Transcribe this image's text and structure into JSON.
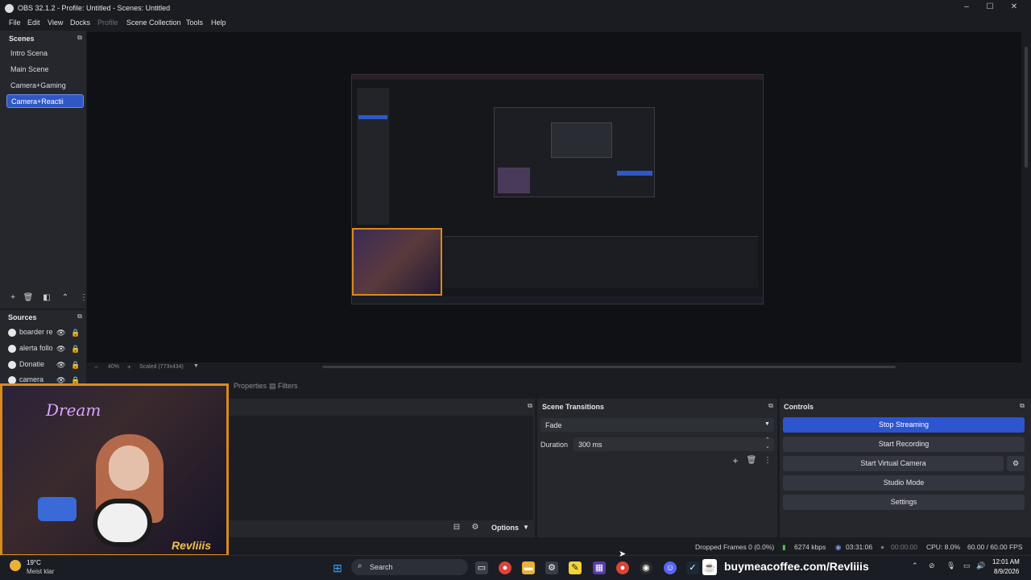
{
  "window": {
    "title": "OBS 32.1.2 - Profile: Untitled - Scenes: Untitled",
    "minimize_glyph": "–",
    "maximize_glyph": "☐",
    "close_glyph": "✕"
  },
  "menu": [
    "File",
    "Edit",
    "View",
    "Docks",
    "Profile",
    "Scene Collection",
    "Tools",
    "Help"
  ],
  "scenes": {
    "header": "Scenes",
    "items": [
      "Intro Scena",
      "Main Scene",
      "Camera+Gaming",
      "Camera+Reactii"
    ],
    "selected_index": 3
  },
  "sources": {
    "header": "Sources",
    "items": [
      "boarder re",
      "alerta follo",
      "Donatie",
      "camera"
    ]
  },
  "preview": {
    "zoom_label": "40%",
    "scale_label": "Scaled (773x434)"
  },
  "tabs": {
    "properties": "Properties",
    "filters": "Filters"
  },
  "audio_mixer": {
    "options_label": "Options"
  },
  "scene_transitions": {
    "header": "Scene Transitions",
    "transition": "Fade",
    "duration_label": "Duration",
    "duration_value": "300 ms"
  },
  "controls": {
    "header": "Controls",
    "buttons": [
      "Stop Streaming",
      "Start Recording",
      "Start Virtual Camera",
      "Studio Mode",
      "Settings"
    ]
  },
  "status": {
    "dropped_frames": "Dropped Frames 0 (0.0%)",
    "bitrate": "6274 kbps",
    "stream_time": "03:31:06",
    "record_time": "00:00:00",
    "cpu": "CPU: 8.0%",
    "fps": "60.00 / 60.00 FPS"
  },
  "webcam": {
    "neon_text": "Dream",
    "brand": "Revliiis"
  },
  "taskbar": {
    "weather_temp": "19°C",
    "weather_desc": "Meist klar",
    "search_placeholder": "Search",
    "banner": "buymeacoffee.com/Revliiis",
    "time": "12:01 AM",
    "date": "8/9/2026"
  },
  "colors": {
    "accent": "#2e55d0",
    "selected_scene": "#2f58c6",
    "webcam_border": "#d98a1e"
  }
}
